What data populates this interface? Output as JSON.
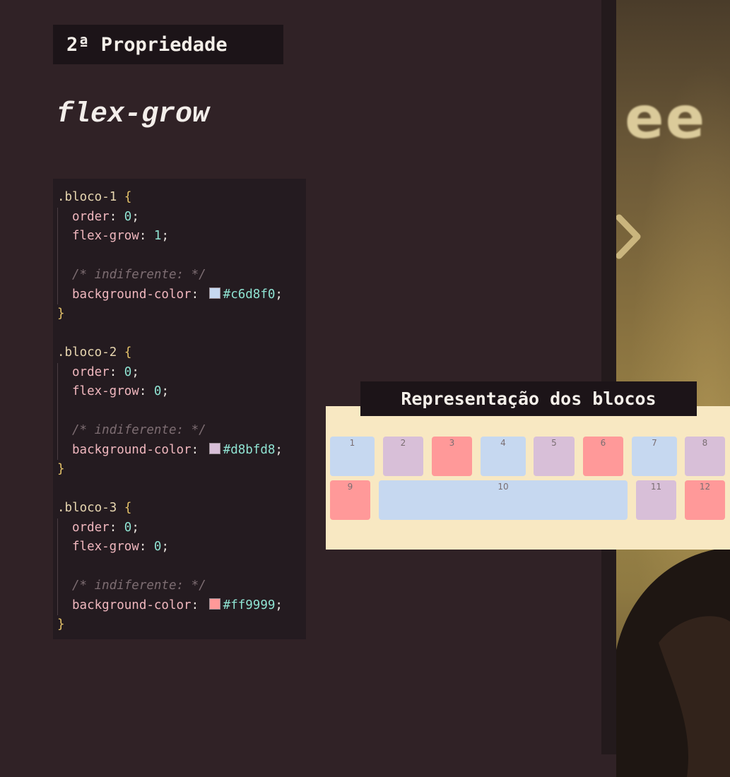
{
  "title": "2ª Propriedade",
  "subtitle": "flex-grow",
  "colors": {
    "background": "#302226",
    "panel": "#241b20",
    "label_bg": "#1c1418",
    "repr_bg": "#f8e8c2"
  },
  "code": {
    "blocks": [
      {
        "selector": ".bloco-1",
        "order_prop": "order",
        "order_value": "0",
        "grow_prop": "flex-grow",
        "grow_value": "1",
        "comment": "/* indiferente: */",
        "bg_prop": "background-color",
        "color": "#c6d8f0"
      },
      {
        "selector": ".bloco-2",
        "order_prop": "order",
        "order_value": "0",
        "grow_prop": "flex-grow",
        "grow_value": "0",
        "comment": "/* indiferente: */",
        "bg_prop": "background-color",
        "color": "#d8bfd8"
      },
      {
        "selector": ".bloco-3",
        "order_prop": "order",
        "order_value": "0",
        "grow_prop": "flex-grow",
        "grow_value": "0",
        "comment": "/* indiferente: */",
        "bg_prop": "background-color",
        "color": "#ff9999"
      }
    ]
  },
  "representation": {
    "label": "Representação dos blocos",
    "blocks": [
      "1",
      "2",
      "3",
      "4",
      "5",
      "6",
      "7",
      "8",
      "9",
      "10",
      "11",
      "12"
    ],
    "block_colors": [
      "#c6d8f0",
      "#d8bfd8",
      "#ff9999",
      "#c6d8f0",
      "#d8bfd8",
      "#ff9999",
      "#c6d8f0",
      "#d8bfd8",
      "#ff9999",
      "#c6d8f0",
      "#d8bfd8",
      "#ff9999"
    ]
  },
  "video": {
    "overlay_text": "ee"
  }
}
